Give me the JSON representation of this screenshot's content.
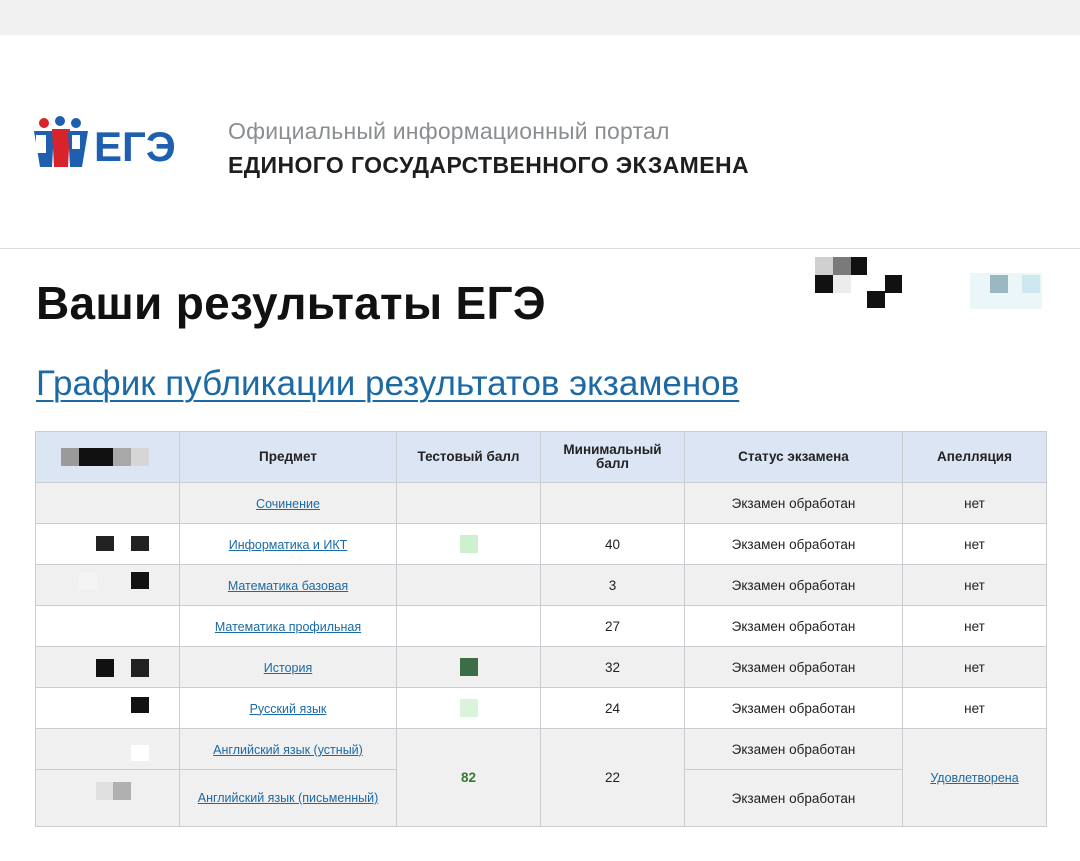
{
  "header": {
    "logo_text": "ЕГЭ",
    "portal_subtitle": "Официальный информационный портал",
    "portal_title": "ЕДИНОГО ГОСУДАРСТВЕННОГО ЭКЗАМЕНА"
  },
  "page": {
    "title": "Ваши результаты ЕГЭ",
    "schedule_link": "График публикации результатов экзаменов"
  },
  "table": {
    "columns": [
      "",
      "Предмет",
      "Тестовый балл",
      "Минимальный балл",
      "Статус экзамена",
      "Апелляция"
    ],
    "rows": [
      {
        "subject": "Сочинение",
        "min": "",
        "status": "Экзамен обработан",
        "appeal": "нет"
      },
      {
        "subject": "Информатика и ИКТ",
        "min": "40",
        "status": "Экзамен обработан",
        "appeal": "нет"
      },
      {
        "subject": "Математика базовая",
        "min": "3",
        "status": "Экзамен обработан",
        "appeal": "нет"
      },
      {
        "subject": "Математика профильная",
        "min": "27",
        "status": "Экзамен обработан",
        "appeal": "нет"
      },
      {
        "subject": "История",
        "min": "32",
        "status": "Экзамен обработан",
        "appeal": "нет"
      },
      {
        "subject": "Русский язык",
        "min": "24",
        "status": "Экзамен обработан",
        "appeal": "нет"
      }
    ],
    "english": {
      "oral_subject": "Английский язык (устный)",
      "written_subject": "Английский язык (письменный)",
      "score": "82",
      "min": "22",
      "oral_status": "Экзамен обработан",
      "written_status": "Экзамен обработан",
      "appeal": "Удовлетворена"
    }
  },
  "colors": {
    "link": "#1b6aa5",
    "header_bg": "#dbe5f3",
    "score_green": "#2e7d32",
    "logo_blue": "#1f5fb0",
    "logo_red": "#d8232a"
  }
}
